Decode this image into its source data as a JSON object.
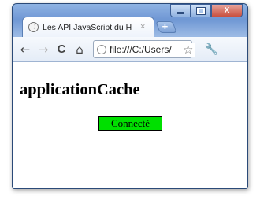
{
  "browser": {
    "tab": {
      "title": "Les API JavaScript du H",
      "close": "×"
    },
    "new_tab": "+",
    "controls": {
      "close": "X"
    },
    "toolbar": {
      "back": "←",
      "forward": "→",
      "reload": "C",
      "home": "⌂",
      "url": "file:///C:/Users/",
      "star": "☆",
      "wrench": "🔧"
    }
  },
  "page": {
    "heading": "applicationCache",
    "status": "Connecté",
    "status_color": "#00e000"
  }
}
